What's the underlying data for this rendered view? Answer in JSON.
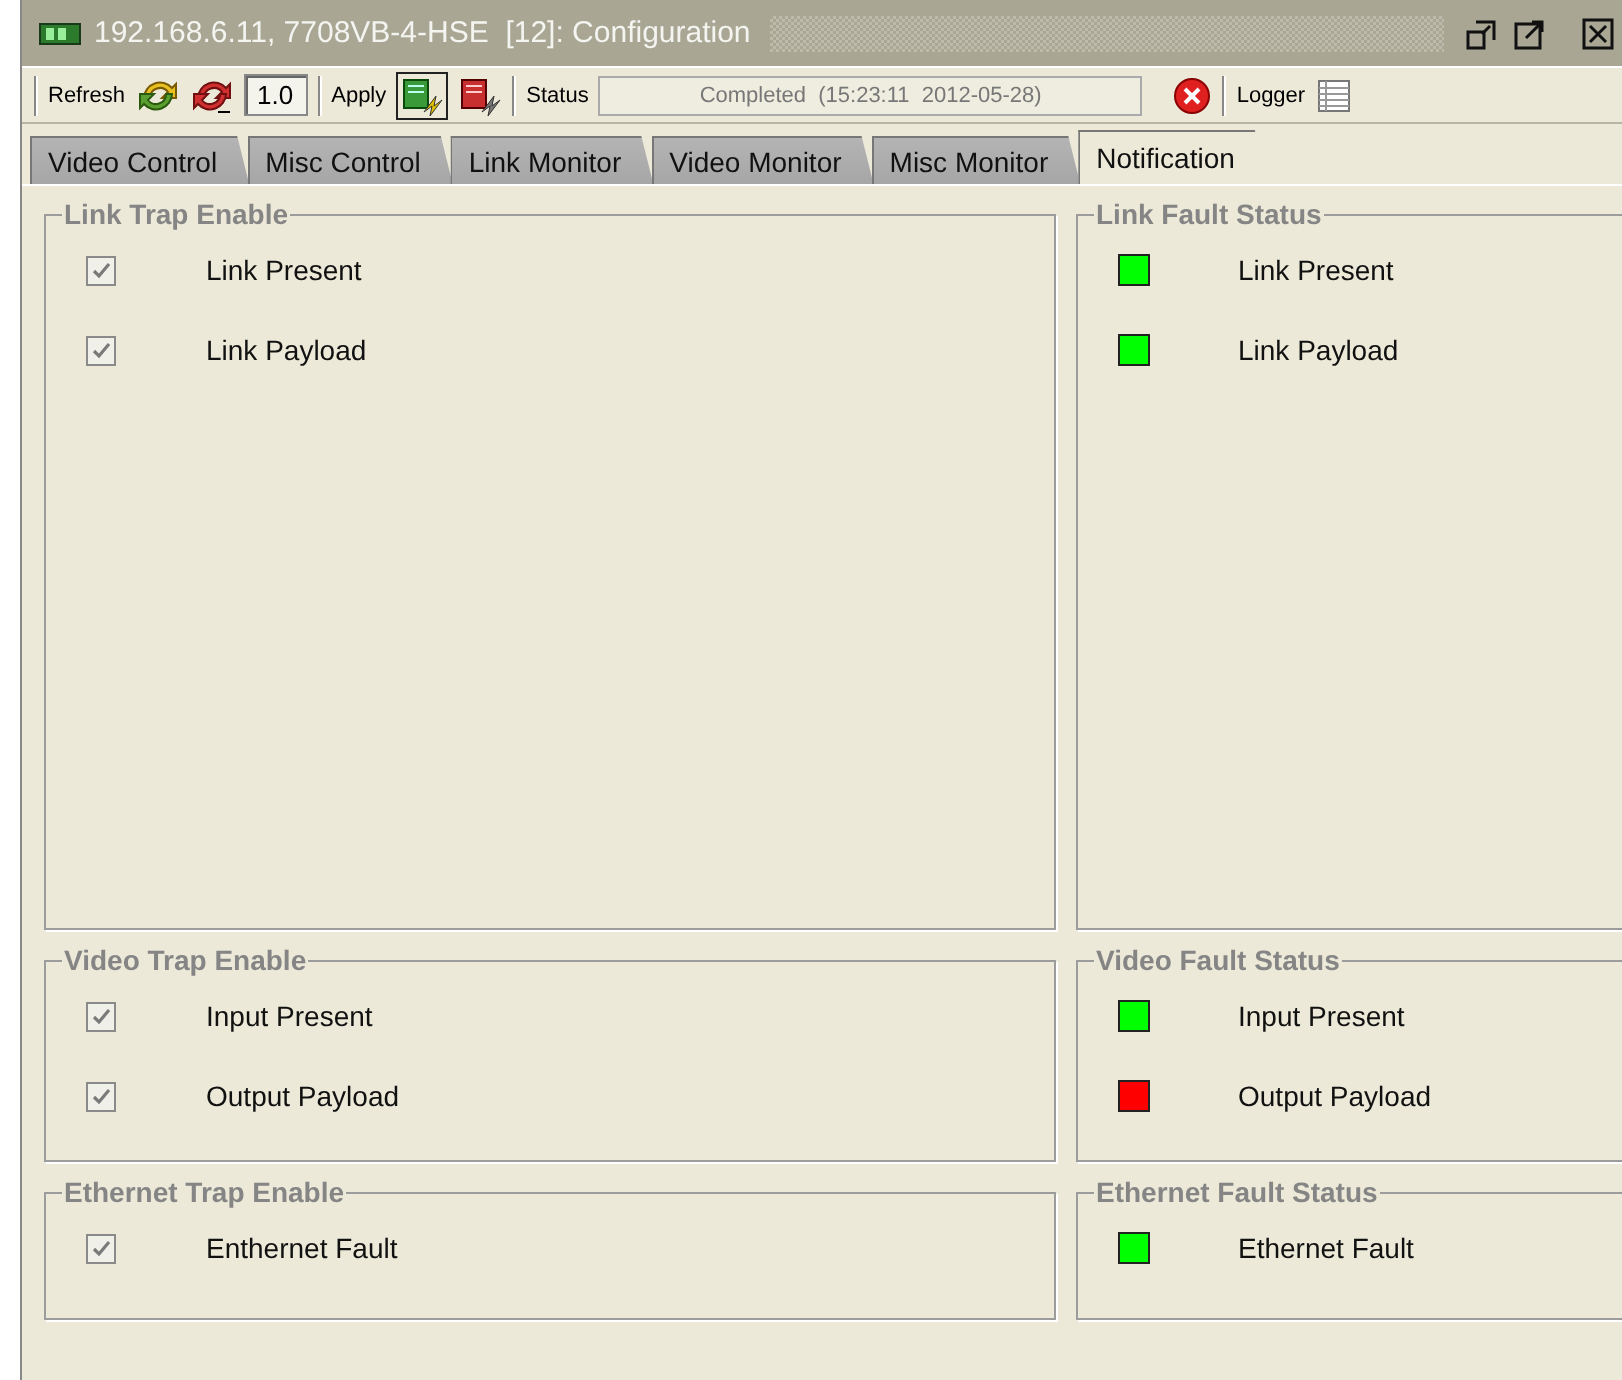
{
  "window": {
    "title": "192.168.6.11, 7708VB-4-HSE  [12]: Configuration"
  },
  "toolbar": {
    "refresh_label": "Refresh",
    "version": "1.0",
    "apply_label": "Apply",
    "status_label": "Status",
    "status": "Completed  (15:23:11  2012-05-28)",
    "logger_label": "Logger"
  },
  "tabs": [
    {
      "label": "Video Control",
      "selected": false
    },
    {
      "label": "Misc Control",
      "selected": false
    },
    {
      "label": "Link Monitor",
      "selected": false
    },
    {
      "label": "Video Monitor",
      "selected": false
    },
    {
      "label": "Misc Monitor",
      "selected": false
    },
    {
      "label": "Notification",
      "selected": true
    }
  ],
  "sections": [
    {
      "trap": {
        "title": "Link Trap Enable",
        "items": [
          {
            "label": "Link Present",
            "checked": true
          },
          {
            "label": "Link Payload",
            "checked": true
          }
        ]
      },
      "fault": {
        "title": "Link Fault Status",
        "items": [
          {
            "label": "Link Present",
            "color": "#00ff00"
          },
          {
            "label": "Link Payload",
            "color": "#00ff00"
          }
        ]
      }
    },
    {
      "trap": {
        "title": "Video Trap Enable",
        "items": [
          {
            "label": "Input Present",
            "checked": true
          },
          {
            "label": "Output Payload",
            "checked": true
          }
        ]
      },
      "fault": {
        "title": "Video Fault Status",
        "items": [
          {
            "label": "Input Present",
            "color": "#00ff00"
          },
          {
            "label": "Output Payload",
            "color": "#ff0000"
          }
        ]
      }
    },
    {
      "trap": {
        "title": "Ethernet Trap Enable",
        "items": [
          {
            "label": "Enthernet Fault",
            "checked": true
          }
        ]
      },
      "fault": {
        "title": "Ethernet Fault Status",
        "items": [
          {
            "label": "Ethernet Fault",
            "color": "#00ff00"
          }
        ]
      }
    }
  ]
}
